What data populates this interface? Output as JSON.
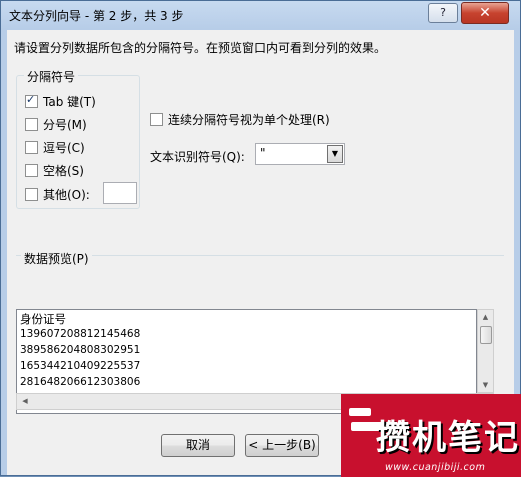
{
  "window": {
    "title": "文本分列向导 - 第 2 步，共 3 步",
    "help_label": "?",
    "close_label": "✕"
  },
  "instruction": "请设置分列数据所包含的分隔符号。在预览窗口内可看到分列的效果。",
  "delimiters": {
    "legend": "分隔符号",
    "items": [
      {
        "label": "Tab 键(T)",
        "checked": true
      },
      {
        "label": "分号(M)",
        "checked": false
      },
      {
        "label": "逗号(C)",
        "checked": false
      },
      {
        "label": "空格(S)",
        "checked": false
      },
      {
        "label": "其他(O):",
        "checked": false
      }
    ],
    "other_value": ""
  },
  "consecutive": {
    "label": "连续分隔符号视为单个处理(R)",
    "checked": false
  },
  "text_qualifier": {
    "label": "文本识别符号(Q):",
    "value": "\""
  },
  "preview": {
    "legend": "数据预览(P)",
    "lines": [
      "身份证号",
      "139607208812145468",
      "389586204808302951",
      "165344210409225537",
      "281648206612303806"
    ]
  },
  "buttons": {
    "cancel": "取消",
    "back": "< 上一步(B)"
  },
  "watermark": {
    "title": "攒机笔记",
    "url": "www.cuanjibiji.com"
  }
}
